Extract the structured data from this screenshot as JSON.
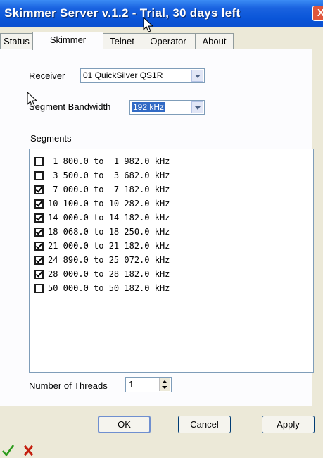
{
  "window": {
    "title": "Skimmer Server v.1.2 - Trial, 30 days left",
    "close_glyph": "X"
  },
  "tabs": [
    {
      "label": "Status",
      "active": false
    },
    {
      "label": "Skimmer",
      "active": true
    },
    {
      "label": "Telnet",
      "active": false
    },
    {
      "label": "Operator",
      "active": false
    },
    {
      "label": "About",
      "active": false
    }
  ],
  "receiver": {
    "label": "Receiver",
    "value": "01 QuickSilver QS1R"
  },
  "segment_bandwidth": {
    "label": "Segment Bandwidth",
    "value": "192 kHz"
  },
  "segments": {
    "label": "Segments",
    "items": [
      {
        "text": " 1 800.0 to  1 982.0 kHz",
        "checked": false
      },
      {
        "text": " 3 500.0 to  3 682.0 kHz",
        "checked": false
      },
      {
        "text": " 7 000.0 to  7 182.0 kHz",
        "checked": true
      },
      {
        "text": "10 100.0 to 10 282.0 kHz",
        "checked": true
      },
      {
        "text": "14 000.0 to 14 182.0 kHz",
        "checked": true
      },
      {
        "text": "18 068.0 to 18 250.0 kHz",
        "checked": true
      },
      {
        "text": "21 000.0 to 21 182.0 kHz",
        "checked": true
      },
      {
        "text": "24 890.0 to 25 072.0 kHz",
        "checked": true
      },
      {
        "text": "28 000.0 to 28 182.0 kHz",
        "checked": true
      },
      {
        "text": "50 000.0 to 50 182.0 kHz",
        "checked": false
      }
    ]
  },
  "threads": {
    "label": "Number of Threads",
    "value": "1"
  },
  "buttons": {
    "ok": "OK",
    "cancel": "Cancel",
    "apply": "Apply"
  },
  "icons": {
    "check": "green-checkmark-icon",
    "cross": "red-x-icon",
    "check_color": "#2a9a1a",
    "cross_color": "#c41e0e"
  }
}
